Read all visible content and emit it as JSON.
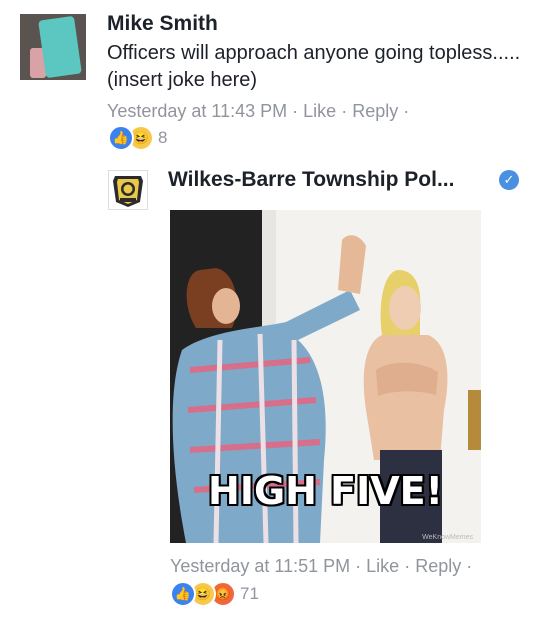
{
  "comment1": {
    "author": "Mike Smith",
    "text": "Officers will approach anyone going topless..... (insert joke here)",
    "timestamp": "Yesterday at 11:43 PM",
    "like_label": "Like",
    "reply_label": "Reply",
    "reaction_count": "8",
    "reactions": [
      "like",
      "haha"
    ]
  },
  "comment2": {
    "author": "Wilkes-Barre Township Pol...",
    "verified": true,
    "image_caption": "HIGH FIVE!",
    "image_watermark": "WeKnowMemes",
    "timestamp": "Yesterday at 11:51 PM",
    "like_label": "Like",
    "reply_label": "Reply",
    "reaction_count": "71",
    "reactions": [
      "like",
      "haha",
      "angry"
    ]
  },
  "separator": "·",
  "colors": {
    "text": "#1d2129",
    "meta": "#90949c",
    "like_blue": "#3b82f1",
    "verified_blue": "#4a90e2"
  }
}
